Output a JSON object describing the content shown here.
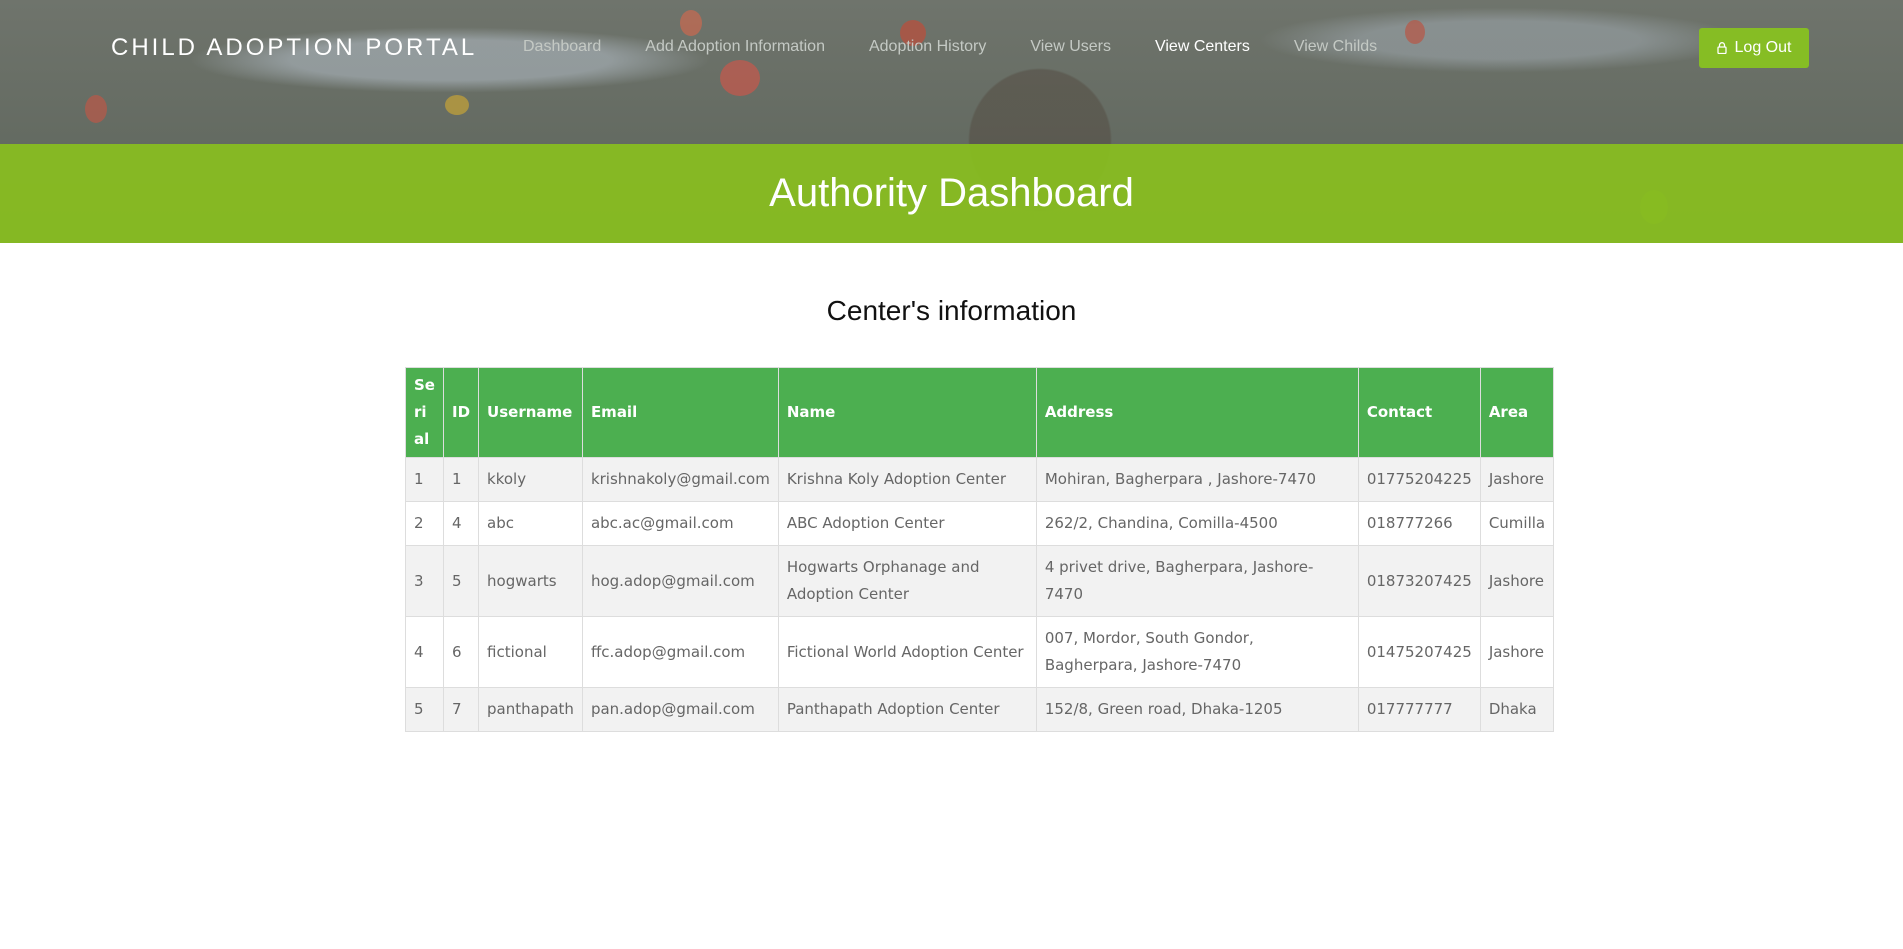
{
  "brand": "CHILD ADOPTION PORTAL",
  "nav": {
    "items": [
      {
        "label": "Dashboard"
      },
      {
        "label": "Add Adoption Information"
      },
      {
        "label": "Adoption History"
      },
      {
        "label": "View Users"
      },
      {
        "label": "View Centers",
        "active": true
      },
      {
        "label": "View Childs"
      }
    ]
  },
  "logout": {
    "label": "Log Out",
    "icon": "lock-icon"
  },
  "banner": {
    "title": "Authority Dashboard"
  },
  "section": {
    "title": "Center's information"
  },
  "table": {
    "headers": [
      "Se ri al",
      "ID",
      "Username",
      "Email",
      "Name",
      "Address",
      "Contact",
      "Area"
    ],
    "rows": [
      [
        "1",
        "1",
        "kkoly",
        "krishnakoly@gmail.com",
        "Krishna Koly Adoption Center",
        "Mohiran, Bagherpara , Jashore-7470",
        "01775204225",
        "Jashore"
      ],
      [
        "2",
        "4",
        "abc",
        "abc.ac@gmail.com",
        "ABC Adoption Center",
        "262/2, Chandina, Comilla-4500",
        "018777266",
        "Cumilla"
      ],
      [
        "3",
        "5",
        "hogwarts",
        "hog.adop@gmail.com",
        "Hogwarts Orphanage and Adoption Center",
        "4 privet drive, Bagherpara, Jashore-7470",
        "01873207425",
        "Jashore"
      ],
      [
        "4",
        "6",
        "fictional",
        "ffc.adop@gmail.com",
        "Fictional World Adoption Center",
        "007, Mordor, South Gondor, Bagherpara, Jashore-7470",
        "01475207425",
        "Jashore"
      ],
      [
        "5",
        "7",
        "panthapath",
        "pan.adop@gmail.com",
        "Panthapath Adoption Center",
        "152/8, Green road, Dhaka-1205",
        "017777777",
        "Dhaka"
      ]
    ]
  },
  "colors": {
    "accent": "#86bd24",
    "table_header": "#4caf50",
    "band": "#89be1f"
  }
}
